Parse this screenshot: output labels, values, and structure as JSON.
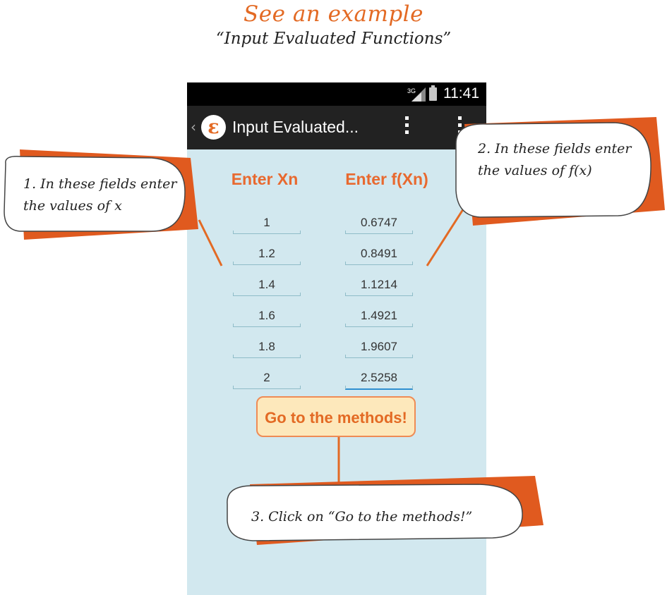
{
  "heading": {
    "title": "See an example",
    "subtitle": "“Input Evaluated Functions”"
  },
  "status_bar": {
    "network": "3G",
    "time": "11:41"
  },
  "action_bar": {
    "logo_letter": "ε",
    "title": "Input Evaluated..."
  },
  "columns": {
    "x_header": "Enter Xn",
    "f_header": "Enter f(Xn)"
  },
  "rows": [
    {
      "x": "1",
      "f": "0.6747"
    },
    {
      "x": "1.2",
      "f": "0.8491"
    },
    {
      "x": "1.4",
      "f": "1.1214"
    },
    {
      "x": "1.6",
      "f": "1.4921"
    },
    {
      "x": "1.8",
      "f": "1.9607"
    },
    {
      "x": "2",
      "f": "2.5258"
    }
  ],
  "button": {
    "label": "Go to the methods!"
  },
  "callouts": {
    "one": {
      "line1": "1. In these fields enter",
      "line2": "the values of x"
    },
    "two": {
      "line1": "2. In these fields enter",
      "line2": "the values of f(x)"
    },
    "three": {
      "line1": "3. Click on “Go to the methods!”"
    }
  },
  "colors": {
    "accent": "#e36a24",
    "phone_bg": "#d2e8ef",
    "button_bg": "#fde8bb"
  },
  "icons": [
    "signal-icon",
    "battery-icon",
    "back-chevron-icon",
    "app-logo-icon",
    "overflow-menu-icon"
  ]
}
